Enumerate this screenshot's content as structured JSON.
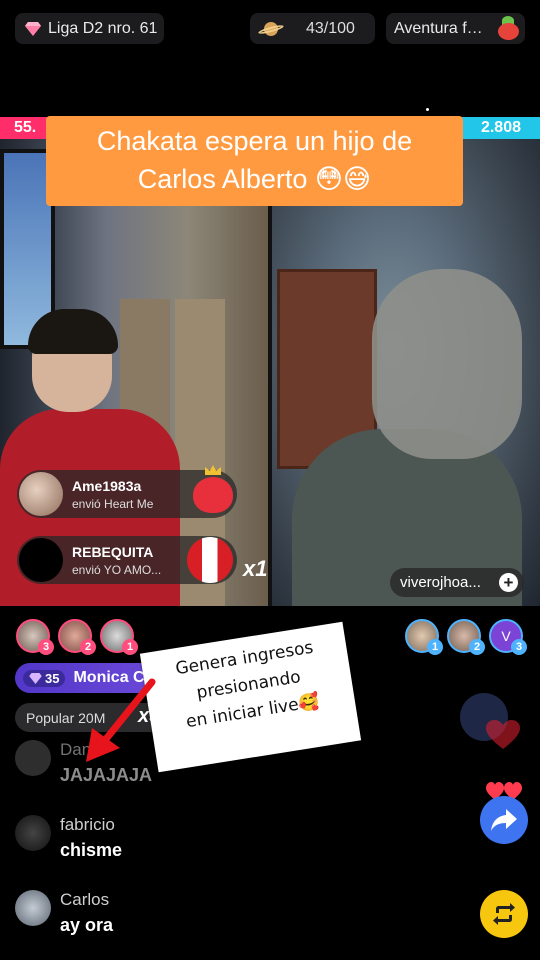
{
  "top_bar": {
    "league_label": "Liga D2 nro. 61",
    "progress_text": "43/100",
    "adventure_label": "Aventura f…",
    "league_icon": "diamond-icon",
    "progress_icon": "planet-icon",
    "adventure_icon": "fruit-sticker-icon"
  },
  "battle": {
    "left_score": "55.",
    "right_score": "2.808",
    "left_color": "#ff2e6a",
    "right_color": "#21c6e8"
  },
  "caption": {
    "text": "Chakata espera un hijo de Carlos Alberto 😳😅",
    "background": "#ff9a41"
  },
  "gifts": [
    {
      "user": "Ame1983a",
      "desc": "envió Heart Me"
    },
    {
      "user": "REBEQUITA",
      "desc": "envió YO AMO..."
    }
  ],
  "gift_combo": "x1",
  "streamer_tag": "viverojhoa...",
  "rankings": {
    "left": [
      "3",
      "2",
      "1"
    ],
    "right": [
      "1",
      "2",
      "3"
    ],
    "right_third_initial": "V"
  },
  "viewer_badge": {
    "level": "35",
    "name": "Monica C"
  },
  "popular": {
    "label": "Popular 20M",
    "multiplier": "x50"
  },
  "sticker": {
    "line1": "Genera ingresos",
    "line2": "presionando",
    "line3": "en iniciar live🥰"
  },
  "comments": [
    {
      "user": "Dan",
      "message": "JAJAJAJA"
    },
    {
      "user": "fabricio",
      "message": "chisme"
    },
    {
      "user": "Carlos",
      "message": "ay ora"
    }
  ]
}
